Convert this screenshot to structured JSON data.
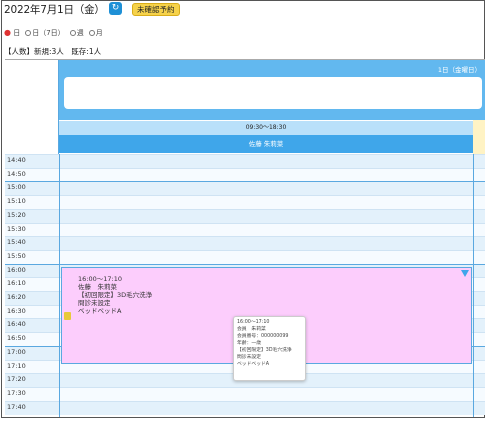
{
  "header": {
    "date_title": "2022年7月1日（金）",
    "refresh_icon": "refresh-icon",
    "unconfirmed_button": "未確認予約"
  },
  "view_switch": {
    "options": [
      "日",
      "日（7日）",
      "週",
      "月"
    ],
    "selected": "日"
  },
  "summary": "【人数】新規:3人　既存:1人",
  "calendar": {
    "day_label": "1日（金曜日）",
    "business_hours": "09:30～18:30",
    "staff_name": "佐藤 朱莉菜",
    "times": [
      "14:40",
      "14:50",
      "15:00",
      "15:10",
      "15:20",
      "15:30",
      "15:40",
      "15:50",
      "16:00",
      "16:10",
      "16:20",
      "16:30",
      "16:40",
      "16:50",
      "17:00",
      "17:10",
      "17:20",
      "17:30",
      "17:40"
    ]
  },
  "booking": {
    "time": "16:00～17:10",
    "customer": "佐藤　朱莉菜",
    "menu": "【初回限定】3D毛穴洗浄",
    "status": "問診未設定",
    "bed": "ベッドベッドA"
  },
  "tooltip": {
    "lines": [
      "16:00～17:10",
      "会員　朱莉菜",
      "会員番号：000000099",
      "年齢：一歳",
      "【初回限定】3D毛穴洗浄",
      "問診未設定",
      "ベッドベッドA"
    ]
  }
}
